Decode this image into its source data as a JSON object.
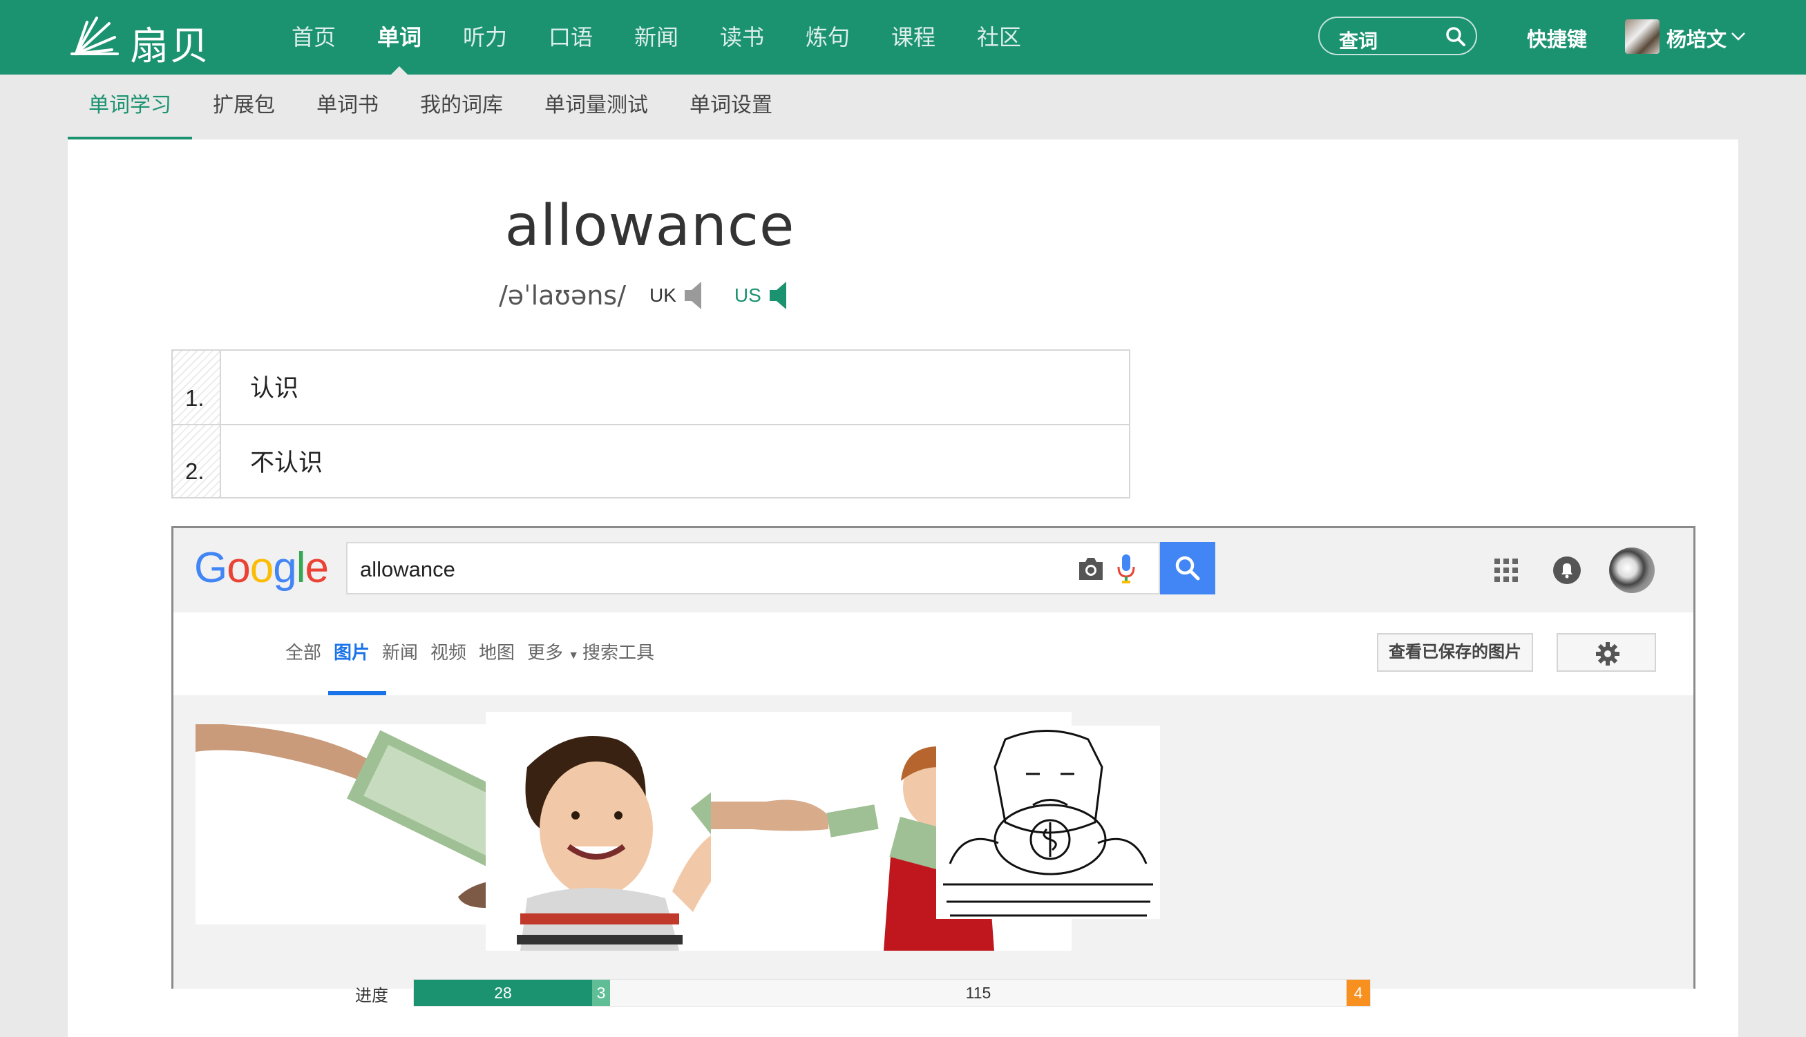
{
  "app": {
    "logo_text": "扇贝",
    "nav": [
      "首页",
      "单词",
      "听力",
      "口语",
      "新闻",
      "读书",
      "炼句",
      "课程",
      "社区"
    ],
    "nav_active": 1,
    "search_label": "查词",
    "shortcut_label": "快捷键",
    "user_name": "杨培文"
  },
  "subnav": {
    "items": [
      "单词学习",
      "扩展包",
      "单词书",
      "我的词库",
      "单词量测试",
      "单词设置"
    ],
    "active": 0
  },
  "word": {
    "text": "allowance",
    "phonetic": "/əˈlaʊəns/",
    "uk_label": "UK",
    "us_label": "US",
    "choices": [
      {
        "num": "1.",
        "label": "认识"
      },
      {
        "num": "2.",
        "label": "不认识"
      }
    ]
  },
  "google": {
    "query": "allowance",
    "tabs": [
      "全部",
      "图片",
      "新闻",
      "视频",
      "地图",
      "更多",
      "搜索工具"
    ],
    "active_tab": 1,
    "saved_button": "查看已保存的图片",
    "icons": [
      "camera-icon",
      "microphone-icon",
      "search-icon",
      "apps-grid-icon",
      "notification-bell-icon",
      "gear-icon"
    ]
  },
  "progress": {
    "label": "进度",
    "segments": [
      {
        "value": "28",
        "color": "#1b9270"
      },
      {
        "value": "3",
        "color": "#5fbe96"
      },
      {
        "value": "115",
        "color": "#f7f7f7"
      },
      {
        "value": "4",
        "color": "#f7901e"
      }
    ]
  },
  "colors": {
    "brand": "#1b9270",
    "google_blue": "#4285f4",
    "progress_orange": "#f7901e"
  }
}
